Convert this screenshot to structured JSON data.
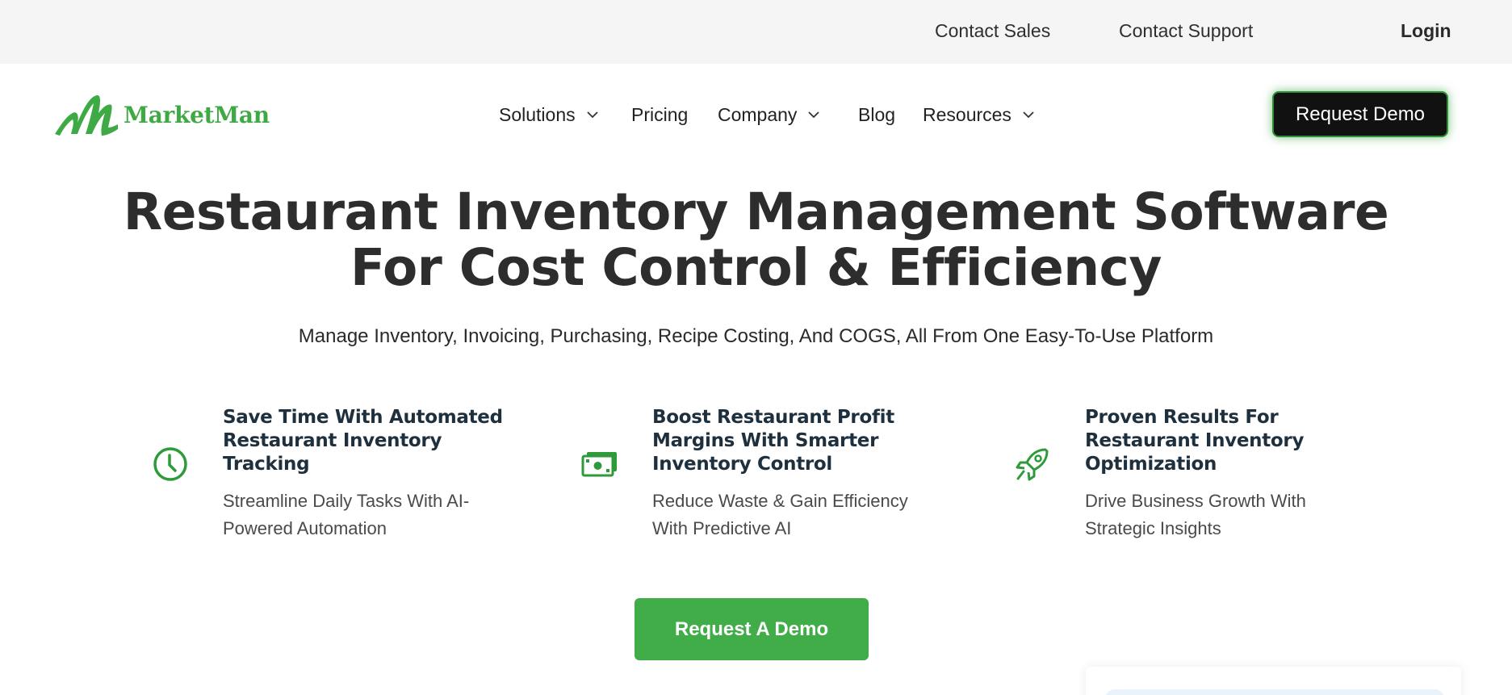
{
  "topbar": {
    "contact_sales": "Contact Sales",
    "contact_support": "Contact Support",
    "login": "Login"
  },
  "logo": {
    "text": "MarketMan",
    "icon": "marketman-m-logo-icon"
  },
  "nav": {
    "items": [
      {
        "label": "Solutions",
        "has_dropdown": true
      },
      {
        "label": "Pricing",
        "has_dropdown": false
      },
      {
        "label": "Company",
        "has_dropdown": true
      },
      {
        "label": "Blog",
        "has_dropdown": false
      },
      {
        "label": "Resources",
        "has_dropdown": true
      }
    ],
    "cta": "Request Demo"
  },
  "hero": {
    "title_line1": "Restaurant Inventory Management Software",
    "title_line2": "For Cost Control & Efficiency",
    "subtitle": "Manage Inventory, Invoicing, Purchasing, Recipe Costing, And COGS, All From One Easy-To-Use Platform"
  },
  "features": [
    {
      "icon": "clock-icon",
      "title": "Save Time With Automated Restaurant Inventory Tracking",
      "description": "Streamline Daily Tasks With AI-Powered Automation"
    },
    {
      "icon": "money-icon",
      "title": "Boost Restaurant Profit Margins With Smarter Inventory Control",
      "description": "Reduce Waste & Gain Efficiency With Predictive AI"
    },
    {
      "icon": "rocket-icon",
      "title": "Proven Results For Restaurant Inventory Optimization",
      "description": "Drive Business Growth With Strategic Insights"
    }
  ],
  "cta_main": "Request A Demo",
  "colors": {
    "brand_green": "#41ad48",
    "topbar_bg": "#f5f5f5",
    "dark_button": "#111111",
    "feature_title": "#1e2f3d"
  }
}
